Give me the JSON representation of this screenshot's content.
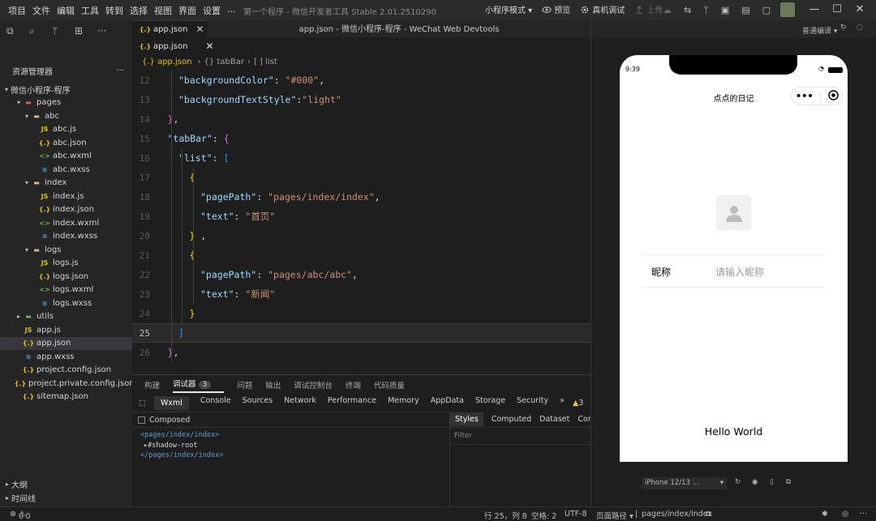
{
  "menubar": {
    "items": [
      "项目",
      "文件",
      "编辑",
      "工具",
      "转到",
      "选择",
      "视图",
      "界面",
      "设置",
      "..."
    ],
    "window_title": "第一个程序 - 微信开发者工具 Stable 2.01.2510290",
    "mode": "小程序模式 ▾",
    "preview": "预览",
    "real_debug": "真机调试",
    "upload": "上传"
  },
  "editor": {
    "caption": "app.json - 微信小程序-程序 - WeChat Web Devtools",
    "tab_label": "app.json",
    "breadcrumb": [
      "{.} app.json",
      "{} tabBar",
      "[ ] list"
    ]
  },
  "explorer": {
    "title": "资源管理器",
    "project": "微信小程序-程序",
    "items": [
      {
        "name": "pages",
        "type": "folder-pages",
        "depth": 1,
        "arrow": "▾"
      },
      {
        "name": "abc",
        "type": "folder",
        "depth": 2,
        "arrow": "▾"
      },
      {
        "name": "abc.js",
        "type": "js",
        "depth": 3
      },
      {
        "name": "abc.json",
        "type": "json",
        "depth": 3
      },
      {
        "name": "abc.wxml",
        "type": "wxml",
        "depth": 3
      },
      {
        "name": "abc.wxss",
        "type": "wxss",
        "depth": 3
      },
      {
        "name": "index",
        "type": "folder",
        "depth": 2,
        "arrow": "▾"
      },
      {
        "name": "index.js",
        "type": "js",
        "depth": 3
      },
      {
        "name": "index.json",
        "type": "json",
        "depth": 3
      },
      {
        "name": "index.wxml",
        "type": "wxml",
        "depth": 3
      },
      {
        "name": "index.wxss",
        "type": "wxss",
        "depth": 3
      },
      {
        "name": "logs",
        "type": "folder",
        "depth": 2,
        "arrow": "▾"
      },
      {
        "name": "logs.js",
        "type": "js",
        "depth": 3
      },
      {
        "name": "logs.json",
        "type": "json",
        "depth": 3
      },
      {
        "name": "logs.wxml",
        "type": "wxml",
        "depth": 3
      },
      {
        "name": "logs.wxss",
        "type": "wxss",
        "depth": 3
      },
      {
        "name": "utils",
        "type": "folder-utils",
        "depth": 1,
        "arrow": "▸"
      },
      {
        "name": "app.js",
        "type": "js",
        "depth": 1
      },
      {
        "name": "app.json",
        "type": "json",
        "depth": 1,
        "active": true
      },
      {
        "name": "app.wxss",
        "type": "wxss",
        "depth": 1
      },
      {
        "name": "project.config.json",
        "type": "json",
        "depth": 1
      },
      {
        "name": "project.private.config.json",
        "type": "json",
        "depth": 1
      },
      {
        "name": "sitemap.json",
        "type": "json",
        "depth": 1
      }
    ],
    "outline": "大纲",
    "timeline": "时间线"
  },
  "code": {
    "current_line": 25,
    "lines": [
      {
        "n": 12,
        "indent": 2,
        "tokens": [
          [
            "k",
            "\"backgroundColor\""
          ],
          [
            "p",
            ": "
          ],
          [
            "s",
            "\"#000\""
          ],
          [
            "p",
            ","
          ]
        ]
      },
      {
        "n": 13,
        "indent": 2,
        "tokens": [
          [
            "k",
            "\"backgroundTextStyle\""
          ],
          [
            "p",
            ":"
          ],
          [
            "s",
            "\"light\""
          ]
        ]
      },
      {
        "n": 14,
        "indent": 1,
        "tokens": [
          [
            "b2",
            "}"
          ],
          [
            "p",
            ","
          ]
        ]
      },
      {
        "n": 15,
        "indent": 1,
        "tokens": [
          [
            "k",
            "\"tabBar\""
          ],
          [
            "p",
            ": "
          ],
          [
            "b2",
            "{"
          ]
        ]
      },
      {
        "n": 16,
        "indent": 2,
        "tokens": [
          [
            "k",
            "\"list\""
          ],
          [
            "p",
            ": "
          ],
          [
            "b3",
            "["
          ]
        ]
      },
      {
        "n": 17,
        "indent": 3,
        "tokens": [
          [
            "b1",
            "{"
          ]
        ]
      },
      {
        "n": 18,
        "indent": 4,
        "tokens": [
          [
            "k",
            "\"pagePath\""
          ],
          [
            "p",
            ": "
          ],
          [
            "s",
            "\"pages/index/index\""
          ],
          [
            "p",
            ","
          ]
        ]
      },
      {
        "n": 19,
        "indent": 4,
        "tokens": [
          [
            "k",
            "\"text\""
          ],
          [
            "p",
            ": "
          ],
          [
            "s",
            "\"首页\""
          ]
        ]
      },
      {
        "n": 20,
        "indent": 3,
        "tokens": [
          [
            "b1",
            "}"
          ],
          [
            "p",
            " ,"
          ]
        ]
      },
      {
        "n": 21,
        "indent": 3,
        "tokens": [
          [
            "b1",
            "{"
          ]
        ]
      },
      {
        "n": 22,
        "indent": 4,
        "tokens": [
          [
            "k",
            "\"pagePath\""
          ],
          [
            "p",
            ": "
          ],
          [
            "s",
            "\"pages/abc/abc\""
          ],
          [
            "p",
            ","
          ]
        ]
      },
      {
        "n": 23,
        "indent": 4,
        "tokens": [
          [
            "k",
            "\"text\""
          ],
          [
            "p",
            ": "
          ],
          [
            "s",
            "\"新闻\""
          ]
        ]
      },
      {
        "n": 24,
        "indent": 3,
        "tokens": [
          [
            "b1",
            "}"
          ]
        ]
      },
      {
        "n": 25,
        "indent": 2,
        "tokens": [
          [
            "b3",
            "]"
          ]
        ]
      },
      {
        "n": 26,
        "indent": 1,
        "tokens": [
          [
            "b2",
            "}"
          ],
          [
            "p",
            ","
          ]
        ]
      }
    ]
  },
  "panel": {
    "tabs": [
      "构建",
      "调试器",
      "问题",
      "输出",
      "调试控制台",
      "终端",
      "代码质量"
    ],
    "active_tab": "调试器",
    "debugger_badge": "3",
    "devtools_tabs": [
      "Wxml",
      "Console",
      "Sources",
      "Network",
      "Performance",
      "Memory",
      "AppData",
      "Storage",
      "Security",
      "»"
    ],
    "warnings": "3",
    "composed_label": "Composed",
    "dom": [
      "<pages/index/index>",
      "▸#shadow-root",
      "</pages/index/index>"
    ],
    "styles_tabs": [
      "Styles",
      "Computed",
      "Dataset",
      "Compo"
    ],
    "filter_placeholder": "Filter"
  },
  "status": {
    "errors": "0",
    "warnings": "0",
    "position": "行 25，列 8",
    "spaces": "空格: 2",
    "encoding": "UTF-8",
    "page_path_label": "页面路径 ▾",
    "page_path": "pages/index/index"
  },
  "simulator": {
    "compile_mode": "普通编译 ▾",
    "time": "9:39",
    "nav_title": "点点的日记",
    "nickname_label": "昵称",
    "nickname_placeholder": "请输入昵称",
    "hello": "Hello World",
    "device": "iPhone 12/13 ...",
    "device_arrow": "▾"
  },
  "colors": {
    "keyword": "#9cdcfe",
    "string": "#ce9178",
    "bracket_1": "#ffd700",
    "bracket_2": "#da70d6",
    "bracket_3": "#179fff"
  }
}
